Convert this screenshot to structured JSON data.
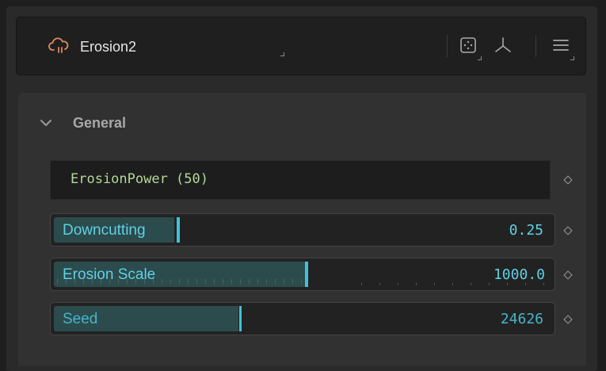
{
  "header": {
    "title": "Erosion2",
    "icon": "cloud-rain-icon",
    "buttons": [
      "grid-dots-icon",
      "axis-icon",
      "menu-icon"
    ]
  },
  "group": {
    "title": "General",
    "expanded": true
  },
  "name_field": {
    "value": "ErosionPower (50)"
  },
  "sliders": [
    {
      "label": "Downcutting",
      "value": "0.25",
      "fill_fraction": 0.25
    },
    {
      "label": "Erosion Scale",
      "value": "1000.0",
      "fill_fraction": 0.5
    },
    {
      "label": "Seed",
      "value": "24626",
      "fill_fraction": 0.38
    }
  ],
  "colors": {
    "accent": "#3ec3da",
    "slider_fill": "#2c4b4d",
    "icon_orange": "#e0895a",
    "name_text": "#b4d89a"
  }
}
